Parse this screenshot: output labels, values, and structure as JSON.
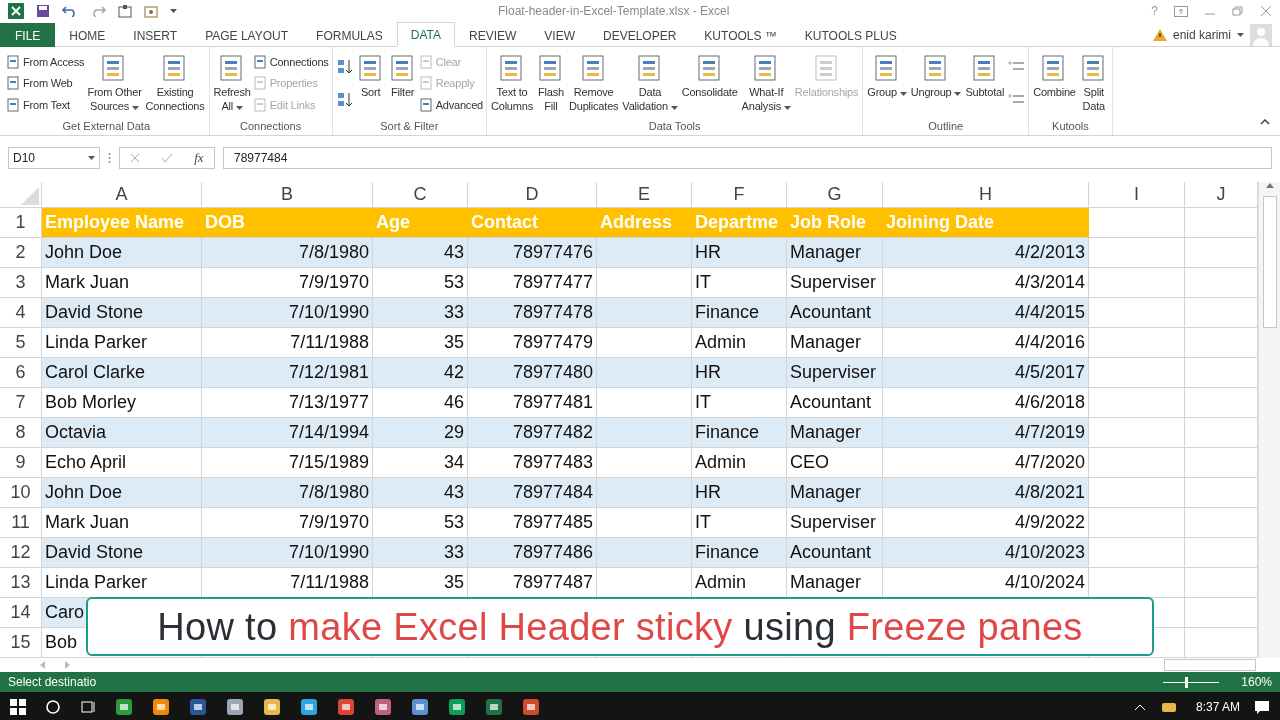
{
  "title_bar": {
    "title": "Float-header-in-Excel-Template.xlsx - Excel",
    "help": "?"
  },
  "tabs": [
    {
      "label": "FILE",
      "kind": "file",
      "selected": false
    },
    {
      "label": "HOME",
      "kind": "tab",
      "selected": false
    },
    {
      "label": "INSERT",
      "kind": "tab",
      "selected": false
    },
    {
      "label": "PAGE LAYOUT",
      "kind": "tab",
      "selected": false
    },
    {
      "label": "FORMULAS",
      "kind": "tab",
      "selected": false
    },
    {
      "label": "DATA",
      "kind": "tab",
      "selected": true
    },
    {
      "label": "REVIEW",
      "kind": "tab",
      "selected": false
    },
    {
      "label": "VIEW",
      "kind": "tab",
      "selected": false
    },
    {
      "label": "DEVELOPER",
      "kind": "tab",
      "selected": false
    },
    {
      "label": "KUTOOLS ™",
      "kind": "tab",
      "selected": false
    },
    {
      "label": "KUTOOLS PLUS",
      "kind": "tab",
      "selected": false
    }
  ],
  "account": {
    "name": "enid karimi"
  },
  "ribbon": {
    "groups": [
      {
        "label": "Get External Data",
        "columns": [
          {
            "kind": "stack",
            "items": [
              {
                "label": "From Access",
                "disabled": false
              },
              {
                "label": "From Web",
                "disabled": false
              },
              {
                "label": "From Text",
                "disabled": false
              }
            ]
          },
          {
            "kind": "large",
            "label": "From Other\nSources",
            "dropdown": true,
            "disabled": false
          },
          {
            "kind": "large",
            "label": "Existing\nConnections",
            "dropdown": false,
            "disabled": false
          }
        ]
      },
      {
        "label": "Connections",
        "columns": [
          {
            "kind": "large",
            "label": "Refresh\nAll",
            "dropdown": true,
            "disabled": false
          },
          {
            "kind": "stack",
            "items": [
              {
                "label": "Connections",
                "disabled": false
              },
              {
                "label": "Properties",
                "disabled": true
              },
              {
                "label": "Edit Links",
                "disabled": true
              }
            ]
          }
        ]
      },
      {
        "label": "Sort & Filter",
        "columns": [
          {
            "kind": "sort-arrows"
          },
          {
            "kind": "large",
            "label": "Sort",
            "dropdown": false,
            "disabled": false
          },
          {
            "kind": "large",
            "label": "Filter",
            "dropdown": false,
            "disabled": false
          },
          {
            "kind": "stack",
            "items": [
              {
                "label": "Clear",
                "disabled": true
              },
              {
                "label": "Reapply",
                "disabled": true
              },
              {
                "label": "Advanced",
                "disabled": false
              }
            ]
          }
        ]
      },
      {
        "label": "Data Tools",
        "columns": [
          {
            "kind": "large",
            "label": "Text to\nColumns",
            "dropdown": false,
            "disabled": false
          },
          {
            "kind": "large",
            "label": "Flash\nFill",
            "dropdown": false,
            "disabled": false
          },
          {
            "kind": "large",
            "label": "Remove\nDuplicates",
            "dropdown": false,
            "disabled": false
          },
          {
            "kind": "large",
            "label": "Data\nValidation",
            "dropdown": true,
            "disabled": false
          },
          {
            "kind": "large",
            "label": "Consolidate",
            "dropdown": false,
            "disabled": false
          },
          {
            "kind": "large",
            "label": "What-If\nAnalysis",
            "dropdown": true,
            "disabled": false
          },
          {
            "kind": "large",
            "label": "Relationships",
            "dropdown": false,
            "disabled": true
          }
        ]
      },
      {
        "label": "Outline",
        "columns": [
          {
            "kind": "large",
            "label": "Group",
            "dropdown": true,
            "disabled": false
          },
          {
            "kind": "large",
            "label": "Ungroup",
            "dropdown": true,
            "disabled": false
          },
          {
            "kind": "large",
            "label": "Subtotal",
            "dropdown": false,
            "disabled": false
          },
          {
            "kind": "detail-icons"
          }
        ]
      },
      {
        "label": "Kutools",
        "columns": [
          {
            "kind": "large",
            "label": "Combine",
            "dropdown": false,
            "disabled": false
          },
          {
            "kind": "large",
            "label": "Split\nData",
            "dropdown": false,
            "disabled": false
          }
        ]
      }
    ]
  },
  "formula_bar": {
    "name_box": "D10",
    "fx": "fx",
    "value": "78977484"
  },
  "sheet": {
    "columns": [
      {
        "letter": "A",
        "right_aligned": false
      },
      {
        "letter": "B",
        "right_aligned": true
      },
      {
        "letter": "C",
        "right_aligned": true
      },
      {
        "letter": "D",
        "right_aligned": true
      },
      {
        "letter": "E"
      },
      {
        "letter": "F",
        "right_aligned": false
      },
      {
        "letter": "G",
        "right_aligned": false
      },
      {
        "letter": "H",
        "right_aligned": true
      },
      {
        "letter": "I"
      },
      {
        "letter": "J"
      }
    ],
    "rows": [
      {
        "number": "1",
        "kind": "header",
        "cells": [
          "Employee Name",
          "DOB",
          "Age",
          "Contact",
          "Address",
          "Departme",
          "Job Role",
          "Joining Date"
        ]
      },
      {
        "number": "2",
        "kind": "data",
        "cells": [
          "John Doe",
          "7/8/1980",
          "43",
          "78977476",
          null,
          "HR",
          "Manager",
          "4/2/2013"
        ]
      },
      {
        "number": "3",
        "kind": "data",
        "cells": [
          "Mark Juan",
          "7/9/1970",
          "53",
          "78977477",
          null,
          "IT",
          "Superviser",
          "4/3/2014"
        ]
      },
      {
        "number": "4",
        "kind": "data",
        "cells": [
          "David Stone",
          "7/10/1990",
          "33",
          "78977478",
          null,
          "Finance",
          "Acountant",
          "4/4/2015"
        ]
      },
      {
        "number": "5",
        "kind": "data",
        "cells": [
          "Linda Parker",
          "7/11/1988",
          "35",
          "78977479",
          null,
          "Admin",
          "Manager",
          "4/4/2016"
        ]
      },
      {
        "number": "6",
        "kind": "data",
        "cells": [
          "Carol Clarke",
          "7/12/1981",
          "42",
          "78977480",
          null,
          "HR",
          "Superviser",
          "4/5/2017"
        ]
      },
      {
        "number": "7",
        "kind": "data",
        "cells": [
          "Bob Morley",
          "7/13/1977",
          "46",
          "78977481",
          null,
          "IT",
          "Acountant",
          "4/6/2018"
        ]
      },
      {
        "number": "8",
        "kind": "data",
        "cells": [
          "Octavia",
          "7/14/1994",
          "29",
          "78977482",
          null,
          "Finance",
          "Manager",
          "4/7/2019"
        ]
      },
      {
        "number": "9",
        "kind": "data",
        "cells": [
          "Echo April",
          "7/15/1989",
          "34",
          "78977483",
          null,
          "Admin",
          "CEO",
          "4/7/2020"
        ]
      },
      {
        "number": "10",
        "kind": "data",
        "cells": [
          "John Doe",
          "7/8/1980",
          "43",
          "78977484",
          null,
          "HR",
          "Manager",
          "4/8/2021"
        ]
      },
      {
        "number": "11",
        "kind": "data",
        "cells": [
          "Mark Juan",
          "7/9/1970",
          "53",
          "78977485",
          null,
          "IT",
          "Superviser",
          "4/9/2022"
        ]
      },
      {
        "number": "12",
        "kind": "data",
        "cells": [
          "David Stone",
          "7/10/1990",
          "33",
          "78977486",
          null,
          "Finance",
          "Acountant",
          "4/10/2023"
        ]
      },
      {
        "number": "13",
        "kind": "data",
        "cells": [
          "Linda Parker",
          "7/11/1988",
          "35",
          "78977487",
          null,
          "Admin",
          "Manager",
          "4/10/2024"
        ]
      },
      {
        "number": "14",
        "kind": "data",
        "cells": [
          "Caro"
        ]
      },
      {
        "number": "15",
        "kind": "data",
        "cells": [
          "Bob"
        ]
      }
    ]
  },
  "status_bar": {
    "message": "Select destinatio",
    "zoom": "160%",
    "zoom_slider": {
      "level": 0.38
    }
  },
  "banner": {
    "parts": [
      {
        "text": "How to ",
        "accent": false
      },
      {
        "text": "make Excel Header sticky",
        "accent": true
      },
      {
        "text": " using ",
        "accent": false
      },
      {
        "text": "Freeze panes",
        "accent": true
      }
    ]
  },
  "taskbar": {
    "time": "8:37 AM"
  }
}
